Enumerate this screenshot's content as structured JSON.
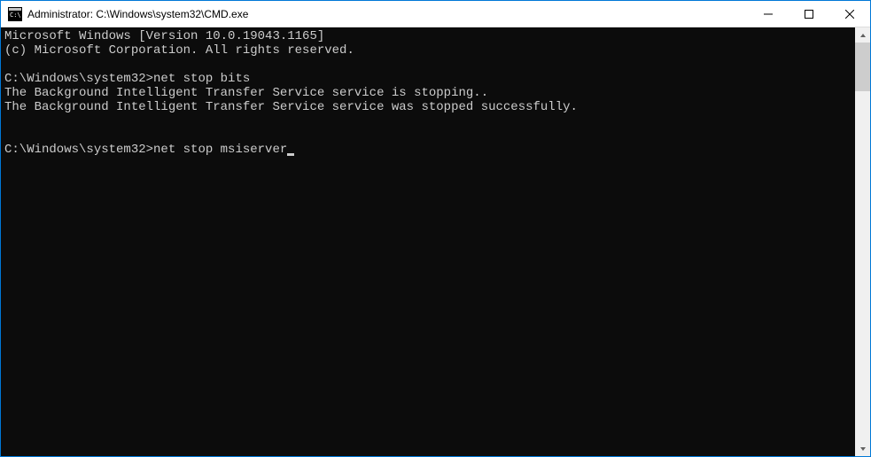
{
  "window": {
    "title": "Administrator: C:\\Windows\\system32\\CMD.exe"
  },
  "terminal": {
    "line1": "Microsoft Windows [Version 10.0.19043.1165]",
    "line2": "(c) Microsoft Corporation. All rights reserved.",
    "blank1": "",
    "prompt1": "C:\\Windows\\system32>",
    "command1": "net stop bits",
    "output1": "The Background Intelligent Transfer Service service is stopping..",
    "output2": "The Background Intelligent Transfer Service service was stopped successfully.",
    "blank2": "",
    "blank3": "",
    "prompt2": "C:\\Windows\\system32>",
    "command2": "net stop msiserver"
  }
}
